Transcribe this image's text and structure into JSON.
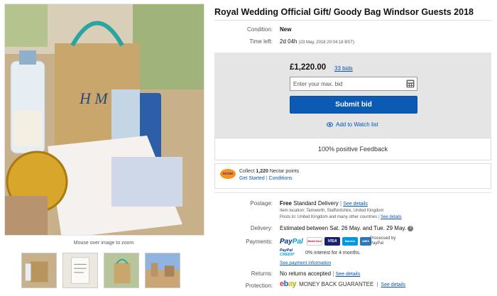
{
  "listing": {
    "title": "Royal Wedding Official Gift/ Goody Bag Windsor Guests 2018"
  },
  "gallery": {
    "caption": "Mouse over image to zoom",
    "thumbnails": [
      "thumbnail-1",
      "thumbnail-2",
      "thumbnail-3",
      "thumbnail-4"
    ]
  },
  "details": {
    "condition_label": "Condition:",
    "condition_value": "New",
    "time_left_label": "Time left:",
    "time_left_value": "2d 04h",
    "time_left_detail": "(23 May, 2018 20:04:18 BST)"
  },
  "bid": {
    "price": "£1,220.00",
    "bids_count": "33 bids",
    "max_bid_placeholder": "Enter your max. bid",
    "submit_label": "Submit bid",
    "watch_label": "Add to Watch list"
  },
  "feedback": {
    "text": "100% positive Feedback"
  },
  "nectar": {
    "logo_text": "nectar",
    "collect_prefix": "Collect",
    "points": "1,220",
    "collect_suffix": "Nectar points",
    "get_started": "Get Started",
    "divider": "|",
    "conditions": "Conditions"
  },
  "postage": {
    "label": "Postage:",
    "free": "Free",
    "service": "Standard Delivery",
    "see_details": "See details",
    "item_location": "Item location: Tamworth, Staffordshire, United Kingdom",
    "posts_to": "Posts to: United Kingdom and many other countries",
    "see_details_2": "See details"
  },
  "delivery": {
    "label": "Delivery:",
    "value": "Estimated between Sat. 26 May. and Tue. 29 May.",
    "info_icon": "?"
  },
  "payments": {
    "label": "Payments:",
    "paypal_text_1": "Pay",
    "paypal_text_2": "Pal",
    "cards": [
      "MasterCard",
      "VISA",
      "Maestro",
      "AMEX"
    ],
    "processed_by": "Processed by PayPal",
    "credit_logo_1": "PayPal",
    "credit_logo_2": "CREDIT",
    "credit_text": "0% interest for 4 months.",
    "see_payment_info": "See payment information"
  },
  "returns": {
    "label": "Returns:",
    "value": "No returns accepted",
    "see_details": "See details"
  },
  "protection": {
    "label": "Protection:",
    "ebay_letters": [
      "e",
      "b",
      "a",
      "y"
    ],
    "ebay_colors": [
      "#e53238",
      "#0064d2",
      "#f5af02",
      "#86b817"
    ],
    "value": "MONEY BACK GUARANTEE",
    "see_details": "See details"
  },
  "colors": {
    "accent": "#0b5ab3",
    "link": "#0654ba",
    "panel": "#e5e5e5"
  }
}
